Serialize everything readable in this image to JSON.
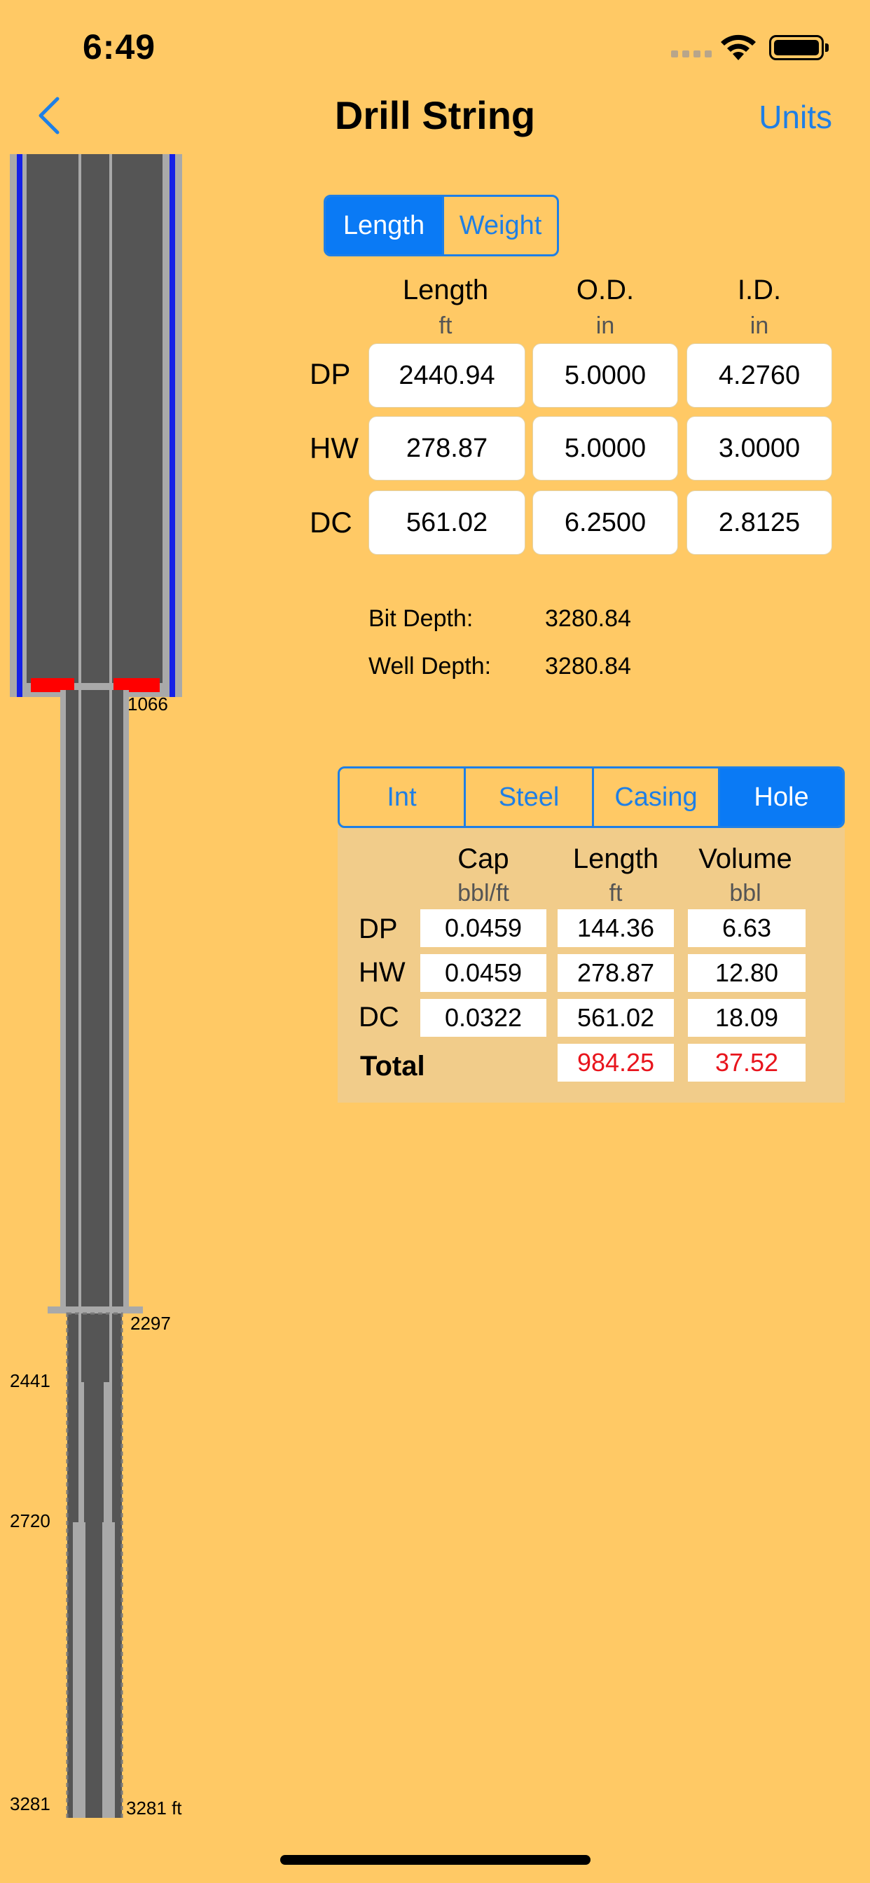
{
  "status_bar": {
    "time": "6:49"
  },
  "nav": {
    "title": "Drill String",
    "right_button": "Units",
    "back_icon": "chevron-left-icon"
  },
  "colors": {
    "background": "#FFC965",
    "accent": "#1E7FE6",
    "red": "#E8141C",
    "panel": "#F1CC8A"
  },
  "diagram": {
    "labels": {
      "casing_shoe": "1066",
      "liner_shoe": "2297",
      "dp_bottom": "2441",
      "hw_bottom": "2720",
      "bit_left": "3281",
      "bit_right": "3281 ft"
    }
  },
  "mode_toggle": {
    "options": [
      "Length",
      "Weight"
    ],
    "selected": "Length"
  },
  "dimensions": {
    "headers": [
      {
        "label": "Length",
        "unit": "ft"
      },
      {
        "label": "O.D.",
        "unit": "in"
      },
      {
        "label": "I.D.",
        "unit": "in"
      }
    ],
    "rows": [
      {
        "label": "DP",
        "values": [
          "2440.94",
          "5.0000",
          "4.2760"
        ]
      },
      {
        "label": "HW",
        "values": [
          "278.87",
          "5.0000",
          "3.0000"
        ]
      },
      {
        "label": "DC",
        "values": [
          "561.02",
          "6.2500",
          "2.8125"
        ]
      }
    ]
  },
  "depths": {
    "bit_depth_label": "Bit Depth:",
    "bit_depth": "3280.84",
    "well_depth_label": "Well Depth:",
    "well_depth": "3280.84"
  },
  "volume_tabs": {
    "options": [
      "Int",
      "Steel",
      "Casing",
      "Hole"
    ],
    "selected": "Hole"
  },
  "volume_table": {
    "headers": [
      {
        "label": "Cap",
        "unit": "bbl/ft"
      },
      {
        "label": "Length",
        "unit": "ft"
      },
      {
        "label": "Volume",
        "unit": "bbl"
      }
    ],
    "rows": [
      {
        "label": "DP",
        "values": [
          "0.0459",
          "144.36",
          "6.63"
        ]
      },
      {
        "label": "HW",
        "values": [
          "0.0459",
          "278.87",
          "12.80"
        ]
      },
      {
        "label": "DC",
        "values": [
          "0.0322",
          "561.02",
          "18.09"
        ]
      }
    ],
    "total": {
      "label": "Total",
      "length": "984.25",
      "volume": "37.52"
    }
  }
}
